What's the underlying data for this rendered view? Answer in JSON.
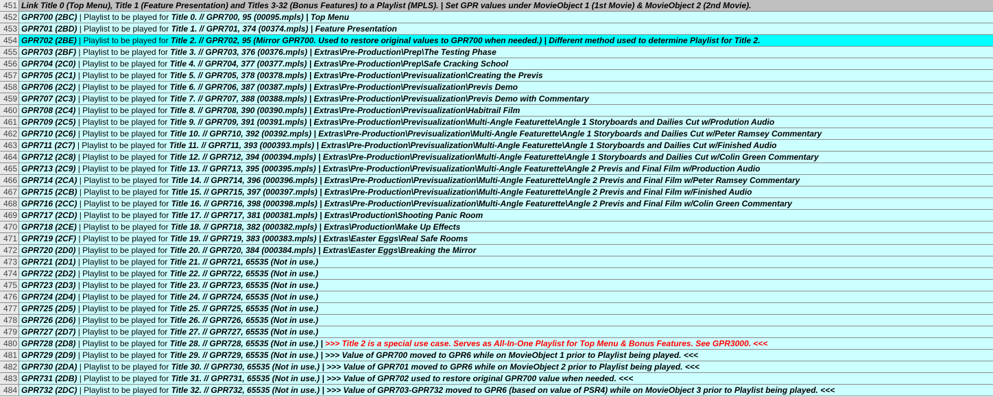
{
  "sheet": {
    "header": {
      "num": "451",
      "text": "Link Title 0 (Top Menu), Title 1 (Feature Presentation) and Titles 3-32 (Bonus Features) to a Playlist (MPLS).  |  Set GPR values under MovieObject 1 (1st Movie) & MovieObject 2 (2nd Movie)."
    },
    "playlist_label": "|  Playlist to be played for ",
    "rows": [
      {
        "num": "452",
        "gpr": "GPR700 (2BC)",
        "title": "Title 0. // GPR700, 95 (00095.mpls)",
        "tail": "|  Top Menu"
      },
      {
        "num": "453",
        "gpr": "GPR701 (2BD)",
        "title": "Title 1. // GPR701, 374 (00374.mpls)",
        "tail": "|  Feature Presentation"
      },
      {
        "num": "454",
        "gpr": "GPR702 (2BE)",
        "title": "Title 2. // GPR702, 95 (Mirror GPR700. Used to restore original values to GPR700 when needed.)",
        "tail": "|  Different method used to determine Playlist for Title 2."
      },
      {
        "num": "455",
        "gpr": "GPR703 (2BF)",
        "title": "Title 3. // GPR703, 376 (00376.mpls)",
        "tail": "|  Extras\\Pre-Production\\Prep\\The Testing Phase"
      },
      {
        "num": "456",
        "gpr": "GPR704 (2C0)",
        "title": "Title 4. // GPR704, 377 (00377.mpls)",
        "tail": "|  Extras\\Pre-Production\\Prep\\Safe Cracking School"
      },
      {
        "num": "457",
        "gpr": "GPR705 (2C1)",
        "title": "Title 5. // GPR705, 378 (00378.mpls)",
        "tail": "|  Extras\\Pre-Production\\Previsualization\\Creating the Previs"
      },
      {
        "num": "458",
        "gpr": "GPR706 (2C2)",
        "title": "Title 6. // GPR706, 387 (00387.mpls)",
        "tail": "|  Extras\\Pre-Production\\Previsualization\\Previs Demo"
      },
      {
        "num": "459",
        "gpr": "GPR707 (2C3)",
        "title": "Title 7. // GPR707, 388 (00388.mpls)",
        "tail": "|  Extras\\Pre-Production\\Previsualization\\Previs Demo with Commentary"
      },
      {
        "num": "460",
        "gpr": "GPR708 (2C4)",
        "title": "Title 8. // GPR708, 390 (00390.mpls)",
        "tail": "|  Extras\\Pre-Production\\Previsualization\\Habitrail Film"
      },
      {
        "num": "461",
        "gpr": "GPR709 (2C5)",
        "title": "Title 9. // GPR709, 391 (00391.mpls)",
        "tail": "|  Extras\\Pre-Production\\Previsualization\\Multi-Angle Featurette\\Angle 1 Storyboards and Dailies Cut w/Prodution Audio"
      },
      {
        "num": "462",
        "gpr": "GPR710 (2C6)",
        "title": "Title 10. // GPR710, 392 (00392.mpls)",
        "tail": " |  Extras\\Pre-Production\\Previsualization\\Multi-Angle Featurette\\Angle 1 Storyboards and Dailies Cut w/Peter Ramsey Commentary"
      },
      {
        "num": "463",
        "gpr": "GPR711 (2C7)",
        "title": "Title 11. // GPR711, 393 (000393.mpls)",
        "tail": " |  Extras\\Pre-Production\\Previsualization\\Multi-Angle Featurette\\Angle 1 Storyboards and Dailies Cut w/Finished Audio"
      },
      {
        "num": "464",
        "gpr": "GPR712 (2C8)",
        "title": "Title 12. // GPR712, 394 (000394.mpls)",
        "tail": " |  Extras\\Pre-Production\\Previsualization\\Multi-Angle Featurette\\Angle 1 Storyboards and Dailies Cut w/Colin Green Commentary"
      },
      {
        "num": "465",
        "gpr": "GPR713 (2C9)",
        "title": "Title 13. // GPR713, 395 (000395.mpls)",
        "tail": " |  Extras\\Pre-Production\\Previsualization\\Multi-Angle Featurette\\Angle 2 Previs and Final Film w/Production Audio"
      },
      {
        "num": "466",
        "gpr": "GPR714 (2CA)",
        "title": "Title 14. // GPR714, 396 (000396.mpls)",
        "tail": " |  Extras\\Pre-Production\\Previsualization\\Multi-Angle Featurette\\Angle 2 Previs and Final Film w/Peter Ramsey Commentary"
      },
      {
        "num": "467",
        "gpr": "GPR715 (2CB)",
        "title": "Title 15. // GPR715, 397 (000397.mpls)",
        "tail": " |  Extras\\Pre-Production\\Previsualization\\Multi-Angle Featurette\\Angle 2 Previs and Final Film w/Finished Audio"
      },
      {
        "num": "468",
        "gpr": "GPR716 (2CC)",
        "title": "Title 16. // GPR716, 398 (000398.mpls)",
        "tail": " |  Extras\\Pre-Production\\Previsualization\\Multi-Angle Featurette\\Angle 2 Previs and Final Film w/Colin Green Commentary"
      },
      {
        "num": "469",
        "gpr": "GPR717 (2CD)",
        "title": "Title 17. // GPR717, 381 (000381.mpls)",
        "tail": " |  Extras\\Production\\Shooting Panic Room"
      },
      {
        "num": "470",
        "gpr": "GPR718 (2CE)",
        "title": "Title 18. // GPR718, 382 (000382.mpls)",
        "tail": " |  Extras\\Production\\Make Up Effects"
      },
      {
        "num": "471",
        "gpr": "GPR719 (2CF)",
        "title": "Title 19. // GPR719, 383 (000383.mpls)",
        "tail": " |  Extras\\Easter Eggs\\Real Safe Rooms"
      },
      {
        "num": "472",
        "gpr": "GPR720 (2D0)",
        "title": "Title 20. // GPR720, 384 (000384.mpls)",
        "tail": " |  Extras\\Easter Eggs\\Breaking the Mirror"
      },
      {
        "num": "473",
        "gpr": "GPR721 (2D1)",
        "title": "Title 21. // GPR721, 65535 (Not in use.)",
        "tail": ""
      },
      {
        "num": "474",
        "gpr": "GPR722 (2D2)",
        "title": "Title 22. // GPR722, 65535 (Not in use.)",
        "tail": ""
      },
      {
        "num": "475",
        "gpr": "GPR723 (2D3)",
        "title": "Title 23. // GPR723, 65535 (Not in use.)",
        "tail": ""
      },
      {
        "num": "476",
        "gpr": "GPR724 (2D4)",
        "title": "Title 24. // GPR724, 65535 (Not in use.)",
        "tail": ""
      },
      {
        "num": "477",
        "gpr": "GPR725 (2D5)",
        "title": "Title 25. // GPR725, 65535 (Not in use.)",
        "tail": ""
      },
      {
        "num": "478",
        "gpr": "GPR726 (2D6)",
        "title": "Title 26. // GPR726, 65535 (Not in use.)",
        "tail": ""
      },
      {
        "num": "479",
        "gpr": "GPR727 (2D7)",
        "title": "Title 27. // GPR727, 65535 (Not in use.)",
        "tail": ""
      },
      {
        "num": "480",
        "gpr": "GPR728 (2D8)",
        "title": "Title 28. // GPR728, 65535 (Not in use.)",
        "tail": "|  ",
        "note": ">>> Title 2 is a special use case. Serves as All-In-One Playlist for Top Menu & Bonus Features. See GPR3000. <<<",
        "red": true
      },
      {
        "num": "481",
        "gpr": "GPR729 (2D9)",
        "title": "Title 29. // GPR729, 65535 (Not in use.)",
        "tail": "|  ",
        "note": ">>> Value of GPR700 moved to GPR6 while on MovieObject 1 prior to Playlist being played. <<<"
      },
      {
        "num": "482",
        "gpr": "GPR730 (2DA)",
        "title": "Title 30. // GPR730, 65535 (Not in use.)",
        "tail": "|  ",
        "note": ">>> Value of GPR701 moved to GPR6 while on MovieObject 2 prior to Playlist being played. <<<"
      },
      {
        "num": "483",
        "gpr": "GPR731 (2DB)",
        "title": "Title 31. // GPR731, 65535 (Not in use.)",
        "tail": "|  ",
        "note": ">>> Value of GPR702 used to restore original GPR700 value when needed. <<<"
      },
      {
        "num": "484",
        "gpr": "GPR732 (2DC)",
        "title": "Title 32. // GPR732, 65535 (Not in use.)",
        "tail": "|  ",
        "note": ">>> Value of GPR703-GPR732 moved to GPR6 (based on value of PSR4) while on MovieObject 3 prior to Playlist being played. <<<"
      }
    ],
    "highlight_row": "454",
    "colors": {
      "row_bg": "#ccffff",
      "highlight_bg": "#00ffff",
      "header_bg": "#c0c0c0",
      "gridline": "#8c8c8c",
      "note_red": "#ff0000"
    }
  }
}
